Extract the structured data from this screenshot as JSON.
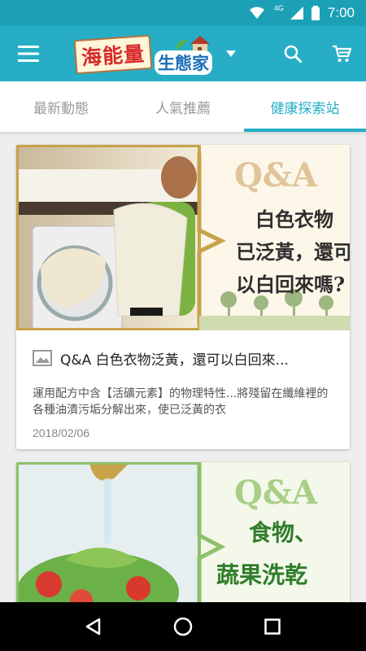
{
  "status_bar": {
    "time": "7:00",
    "network": "4G"
  },
  "app_bar": {
    "logo_main": "海能量",
    "logo_sub": "生態家"
  },
  "tabs": [
    {
      "label": "最新動態"
    },
    {
      "label": "人氣推薦"
    },
    {
      "label": "健康探索站"
    }
  ],
  "articles": [
    {
      "title": "Q&A 白色衣物泛黃，還可以白回來...",
      "description": "運用配方中含【活礦元素】的物理特性...將殘留在纖維裡的各種油漬污垢分解出來，使已泛黃的衣",
      "date": "2018/02/06",
      "image_heading": "Q&A",
      "image_caption_lines": [
        "白色衣物",
        "已泛黃，還可",
        "以白回來嗎?"
      ]
    },
    {
      "image_heading": "Q&A",
      "image_caption_lines": [
        "食物、",
        "蔬果洗乾"
      ]
    }
  ],
  "colors": {
    "primary": "#27aec6",
    "status": "#1ba0b6",
    "accent": "#27aec6"
  }
}
